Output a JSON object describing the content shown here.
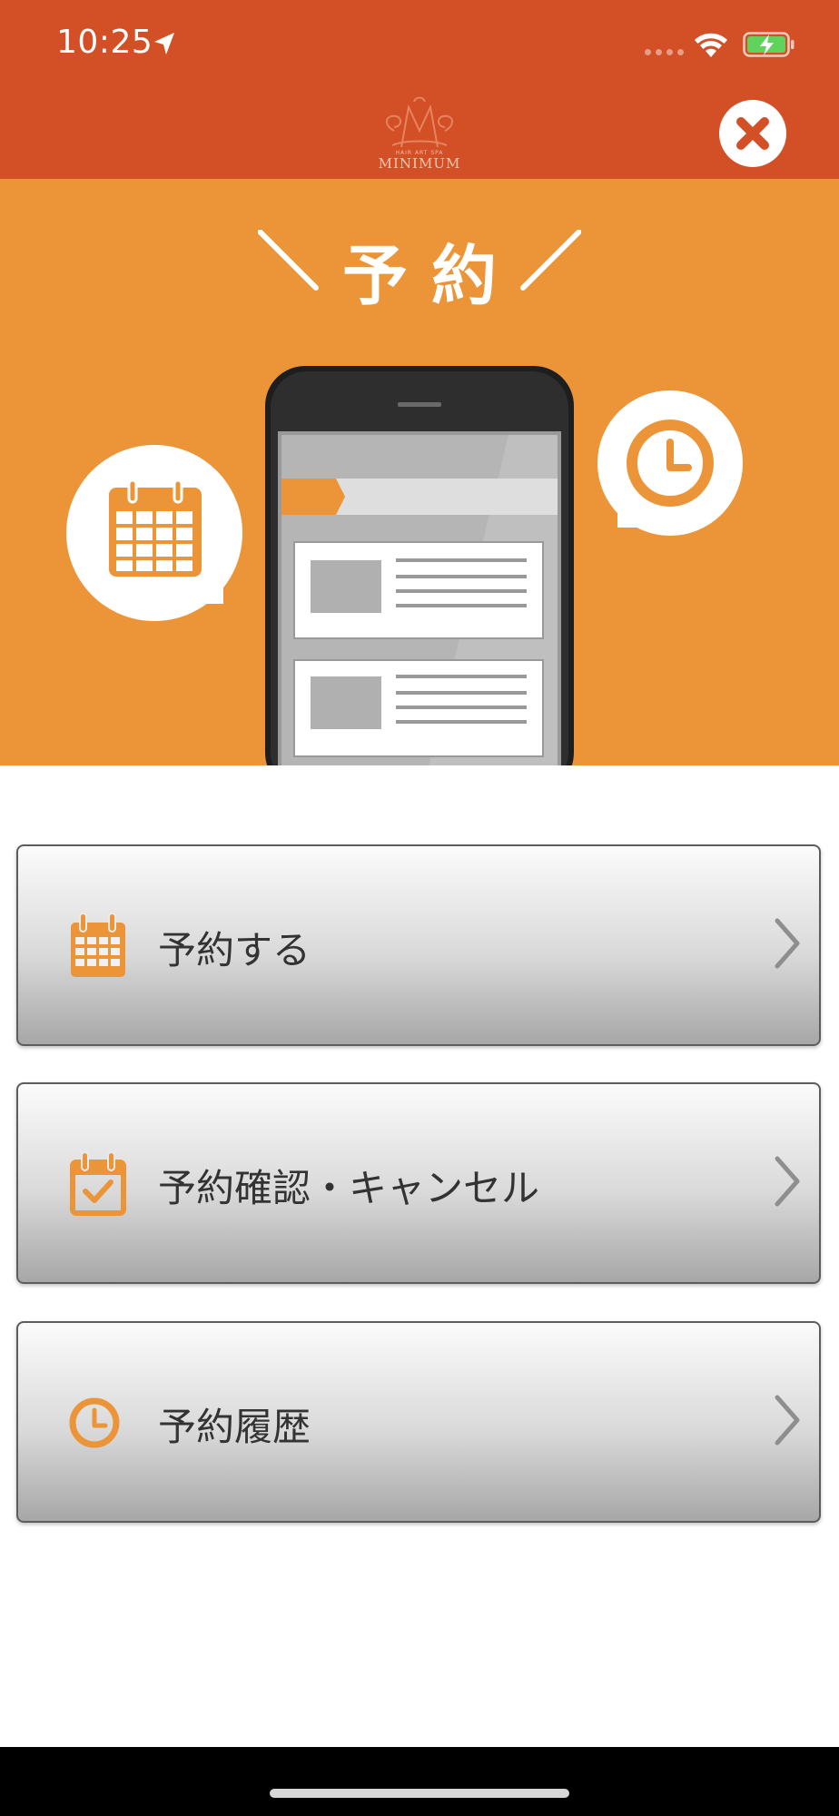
{
  "status_bar": {
    "time": "10:25",
    "icons": [
      "location-arrow-icon",
      "signal-icon",
      "wifi-icon",
      "battery-charging-icon"
    ]
  },
  "header": {
    "brand_sub": "HAIR ART SPA",
    "brand_name": "MINIMUM",
    "close_icon": "close-icon"
  },
  "hero": {
    "title": "予約"
  },
  "menu": {
    "items": [
      {
        "label": "予約する",
        "icon": "calendar-icon"
      },
      {
        "label": "予約確認・キャンセル",
        "icon": "calendar-check-icon"
      },
      {
        "label": "予約履歴",
        "icon": "clock-icon"
      }
    ]
  },
  "colors": {
    "header_bg": "#d34f25",
    "hero_bg": "#ec9538",
    "accent": "#ec9538",
    "button_label": "#333333"
  }
}
